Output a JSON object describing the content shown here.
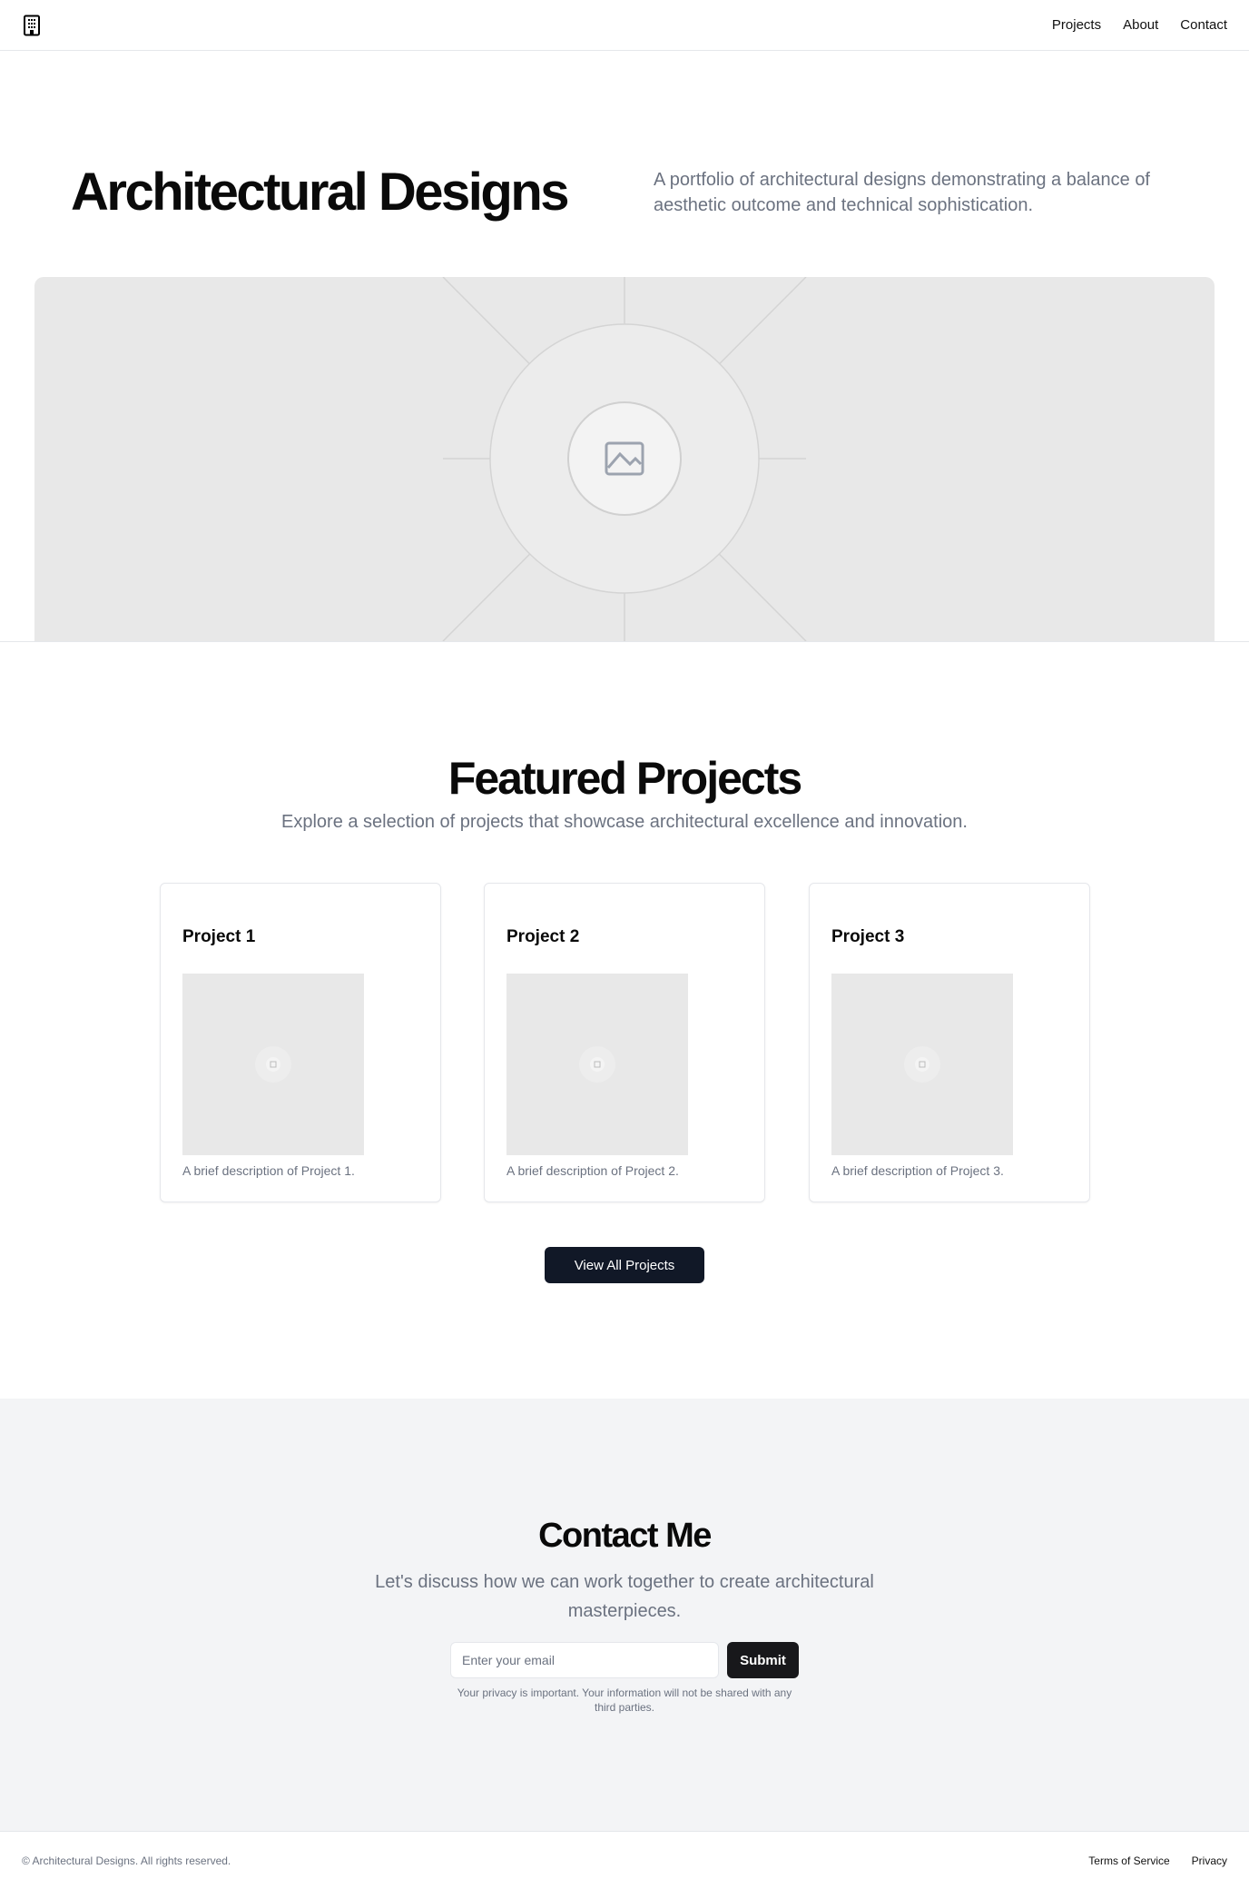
{
  "header": {
    "logo_icon": "building-icon",
    "nav": [
      "Projects",
      "About",
      "Contact"
    ]
  },
  "hero": {
    "title": "Architectural Designs",
    "subtitle": "A portfolio of architectural designs demonstrating a balance of aesthetic outcome and technical sophistication.",
    "image_icon": "image-placeholder-icon"
  },
  "featured": {
    "title": "Featured Projects",
    "subtitle": "Explore a selection of projects that showcase architectural excellence and innovation.",
    "projects": [
      {
        "title": "Project 1",
        "description": "A brief description of Project 1."
      },
      {
        "title": "Project 2",
        "description": "A brief description of Project 2."
      },
      {
        "title": "Project 3",
        "description": "A brief description of Project 3."
      }
    ],
    "button": "View All Projects"
  },
  "contact": {
    "title": "Contact Me",
    "subtitle": "Let's discuss how we can work together to create architectural masterpieces.",
    "email_placeholder": "Enter your email",
    "submit": "Submit",
    "privacy": "Your privacy is important. Your information will not be shared with any third parties."
  },
  "footer": {
    "copyright": "© Architectural Designs. All rights reserved.",
    "links": [
      "Terms of Service",
      "Privacy"
    ]
  }
}
